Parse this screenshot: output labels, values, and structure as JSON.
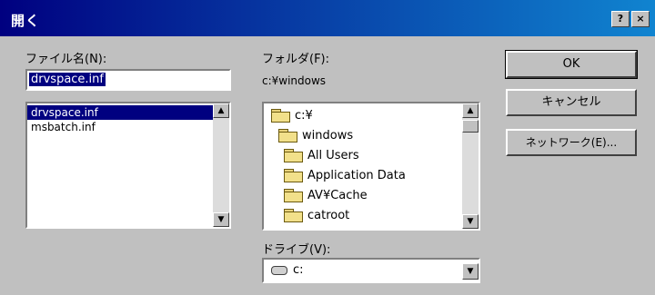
{
  "window": {
    "title": "開く",
    "help_label": "?",
    "close_label": "×"
  },
  "filename": {
    "label": "ファイル名(N):",
    "value": "drvspace.inf",
    "files": [
      "drvspace.inf",
      "msbatch.inf"
    ]
  },
  "folder": {
    "label": "フォルダ(F):",
    "path": "c:¥windows",
    "items": [
      {
        "name": "c:¥",
        "icon": "open-folder-icon"
      },
      {
        "name": "windows",
        "icon": "open-folder-icon"
      },
      {
        "name": "All Users",
        "icon": "folder-icon"
      },
      {
        "name": "Application Data",
        "icon": "folder-icon"
      },
      {
        "name": "AV¥Cache",
        "icon": "folder-icon"
      },
      {
        "name": "catroot",
        "icon": "folder-icon"
      }
    ]
  },
  "drive": {
    "label": "ドライブ(V):",
    "value": "c:",
    "icon": "drive-icon"
  },
  "buttons": {
    "ok": "OK",
    "cancel": "キャンセル",
    "network": "ネットワーク(E)..."
  },
  "scroll_arrows": {
    "up": "▲",
    "down": "▼"
  }
}
